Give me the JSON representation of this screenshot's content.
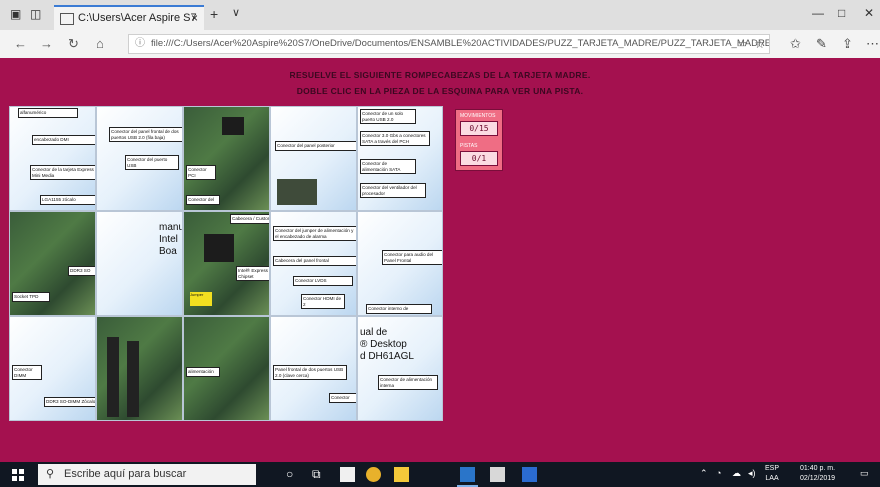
{
  "browser": {
    "tab_title": "C:\\Users\\Acer Aspire S7",
    "tab_close": "×",
    "new_tab": "+",
    "tab_dropdown": "∨",
    "url": "file:///C:/Users/Acer%20Aspire%20S7/OneDrive/Documentos/ENSAMBLE%20ACTIVIDADES/PUZZ_TARJETA_MADRE/PUZZ_TARJETA_MADRE.htm"
  },
  "page": {
    "instruction_line1": "RESUELVE EL SIGUIENTE ROMPECABEZAS DE LA TARJETA MADRE.",
    "instruction_line2": "DOBLE CLIC EN LA PIEZA DE LA ESQUINA PARA VER UNA PISTA.",
    "background_color": "#a4114f",
    "counters": {
      "moves_label": "MOVIMIENTOS",
      "moves_value": "0/15",
      "hints_label": "PISTAS",
      "hints_value": "0/1"
    },
    "pieces": {
      "p00": [
        "alfanumérico",
        "encabezado DMI",
        "Conector de la tarjeta Express Mini Media",
        "LGA1155 zócalo"
      ],
      "p01": [
        "Conector del panel frontal de dos puertos USB 2.0 (fila baja)",
        "Conector del puerto USB"
      ],
      "p02": [
        "Conector PCI",
        "Conector del"
      ],
      "p03": [
        "Conector del panel posterior"
      ],
      "p04": [
        "Conector de un solo puerto USB 2.0",
        "Conector 3.0 Gbs a conectores SATA a través del PCH",
        "Conector de alimentación SATA",
        "Conector del ventilador del procesador"
      ],
      "p10": [
        "DDR3 SO",
        "Socket TPD"
      ],
      "p11": [
        "manual",
        "Intel",
        "Boa"
      ],
      "p12": [
        "Cabecera / Custom",
        "Intel® Express Chipset",
        "Jumper"
      ],
      "p13": [
        "Conector del jumper de alimentación y el encabezado de alarma",
        "Cabecera del panel frontal",
        "Conector LVDS",
        "Conector HDMI de 2"
      ],
      "p14": [
        "Conector para audio del Panel Frontal",
        "Conector interno de"
      ],
      "p20": [
        "Conector DIMM",
        "DDR3 SO-DIMM Zócalo"
      ],
      "p22": [
        "alimentación"
      ],
      "p23": [
        "Panel frontal de dos puertos USB 2.0 (clave cerca)",
        "Conector"
      ],
      "p24": [
        "ual de",
        "® Desktop",
        "d DH61AGL",
        "Conector de alimentación interna"
      ]
    }
  },
  "taskbar": {
    "search_placeholder": "Escribe aquí para buscar",
    "language": "ESP",
    "language_sub": "LAA",
    "time": "01:40 p. m.",
    "date": "02/12/2019"
  },
  "icons": [
    "back-icon",
    "forward-icon",
    "refresh-icon",
    "home-icon",
    "info-icon",
    "reading-view-icon",
    "favorite-star-icon",
    "favorites-hub-icon",
    "pen-icon",
    "share-icon",
    "windows-start-icon",
    "search-icon",
    "task-view-icon",
    "edge-icon",
    "file-explorer-icon",
    "store-icon",
    "chrome-icon",
    "photos-icon"
  ]
}
